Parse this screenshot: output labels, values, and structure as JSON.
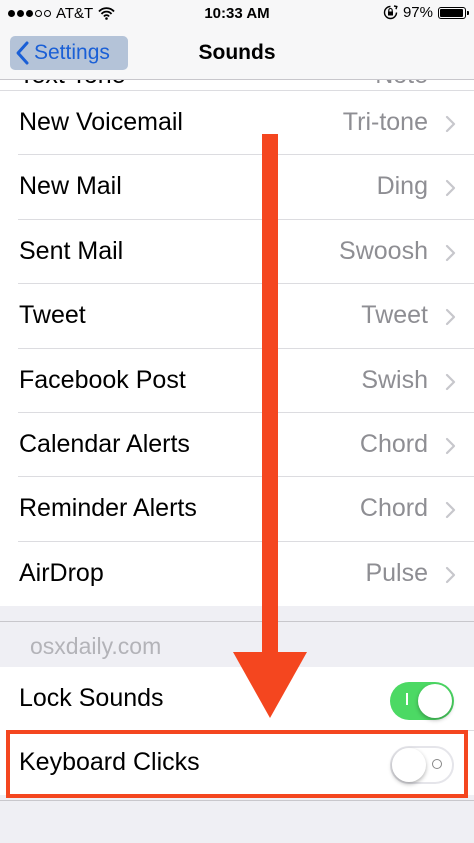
{
  "status": {
    "carrier": "AT&T",
    "time": "10:33 AM",
    "battery": "97%",
    "battery_level": 0.97
  },
  "nav": {
    "back_label": "Settings",
    "title": "Sounds"
  },
  "partial_row": {
    "label": "Text Tone",
    "value": "Note"
  },
  "rows": [
    {
      "label": "New Voicemail",
      "value": "Tri-tone"
    },
    {
      "label": "New Mail",
      "value": "Ding"
    },
    {
      "label": "Sent Mail",
      "value": "Swoosh"
    },
    {
      "label": "Tweet",
      "value": "Tweet"
    },
    {
      "label": "Facebook Post",
      "value": "Swish"
    },
    {
      "label": "Calendar Alerts",
      "value": "Chord"
    },
    {
      "label": "Reminder Alerts",
      "value": "Chord"
    },
    {
      "label": "AirDrop",
      "value": "Pulse"
    }
  ],
  "watermark": "osxdaily.com",
  "toggles": [
    {
      "label": "Lock Sounds",
      "state": "on"
    },
    {
      "label": "Keyboard Clicks",
      "state": "off"
    }
  ],
  "colors": {
    "accent": "#1a5fd6",
    "toggle_on": "#4cd964",
    "annotation": "#f4461f"
  }
}
